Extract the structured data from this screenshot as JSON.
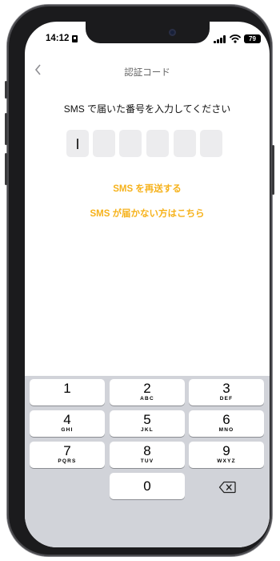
{
  "status_bar": {
    "time": "14:12",
    "battery": "79"
  },
  "nav": {
    "back_icon": "chevron-left-icon",
    "title": "認証コード"
  },
  "prompt": "SMS で届いた番号を入力してください",
  "code_inputs": [
    "",
    "",
    "",
    "",
    "",
    ""
  ],
  "links": {
    "resend": "SMS を再送する",
    "not_received": "SMS が届かない方はこちら"
  },
  "keypad": {
    "keys": [
      {
        "num": "1",
        "letters": ""
      },
      {
        "num": "2",
        "letters": "ABC"
      },
      {
        "num": "3",
        "letters": "DEF"
      },
      {
        "num": "4",
        "letters": "GHI"
      },
      {
        "num": "5",
        "letters": "JKL"
      },
      {
        "num": "6",
        "letters": "MNO"
      },
      {
        "num": "7",
        "letters": "PQRS"
      },
      {
        "num": "8",
        "letters": "TUV"
      },
      {
        "num": "9",
        "letters": "WXYZ"
      },
      {
        "num": "0",
        "letters": ""
      }
    ],
    "delete_icon": "backspace-icon"
  },
  "colors": {
    "accent": "#f6b21b",
    "input_bg": "#ececee",
    "keyboard_bg": "#d1d3d9"
  }
}
